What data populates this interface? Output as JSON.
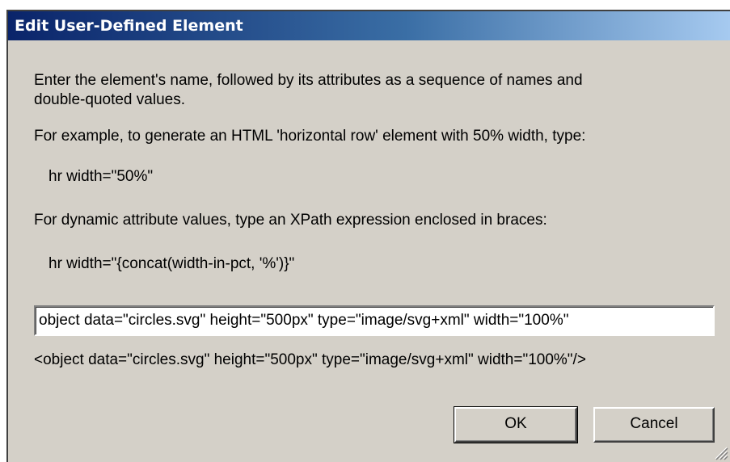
{
  "dialog": {
    "title": "Edit User-Defined Element",
    "instructions_line1": "Enter the element's name, followed by its attributes as a sequence of names and",
    "instructions_line2": "double-quoted values.",
    "example_intro": "For example, to generate an HTML 'horizontal row' element with 50% width, type:",
    "example_code": "hr width=\"50%\"",
    "dynamic_intro": "For dynamic attribute values, type an XPath expression enclosed in braces:",
    "dynamic_code": "hr width=\"{concat(width-in-pct, '%')}\"",
    "input_value": "object data=\"circles.svg\" height=\"500px\" type=\"image/svg+xml\" width=\"100%\"",
    "preview": "<object data=\"circles.svg\" height=\"500px\" type=\"image/svg+xml\" width=\"100%\"/>",
    "ok_label": "OK",
    "cancel_label": "Cancel"
  },
  "colors": {
    "titlebar_start": "#0a246a",
    "titlebar_end": "#a6caf0",
    "dialog_background": "#d4d0c8"
  }
}
